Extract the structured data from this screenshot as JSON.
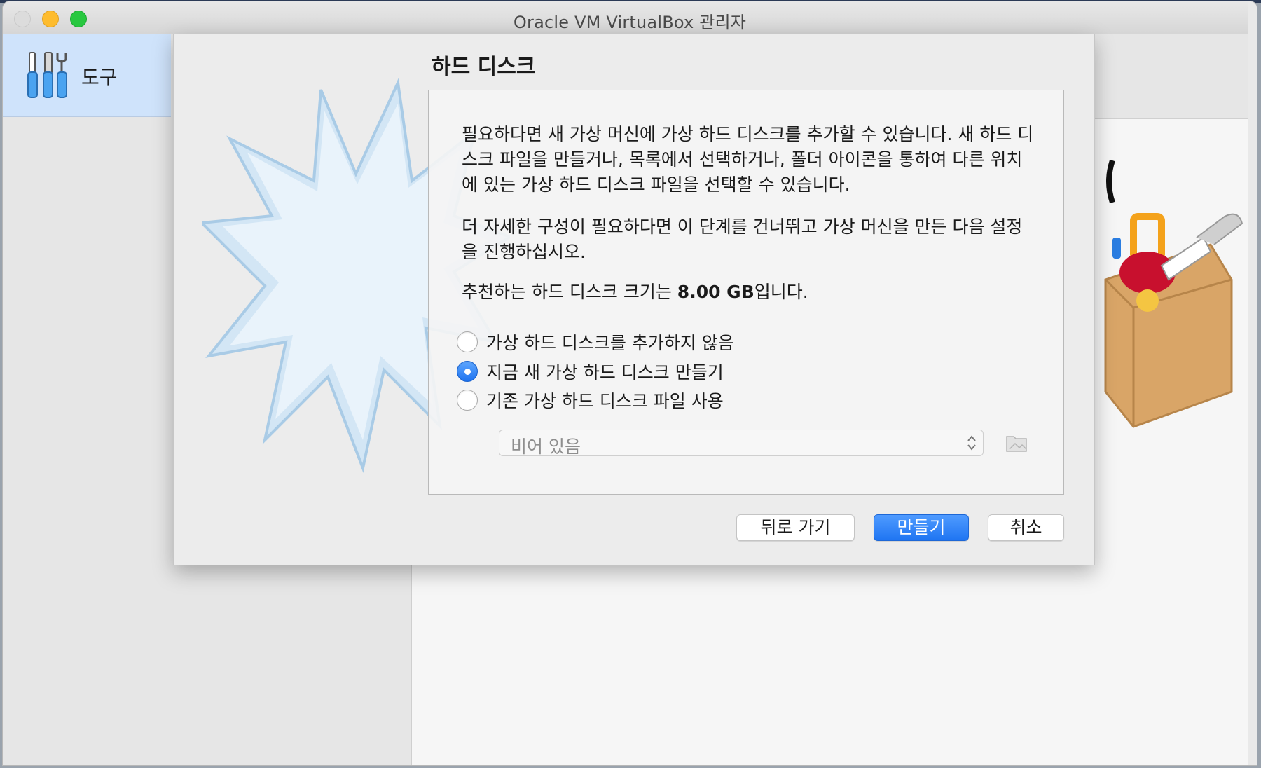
{
  "window": {
    "title": "Oracle VM VirtualBox 관리자"
  },
  "sidebar": {
    "tools_label": "도구"
  },
  "dialog": {
    "title": "하드 디스크",
    "paragraph1": "필요하다면 새 가상 머신에 가상 하드 디스크를 추가할 수 있습니다. 새 하드 디스크 파일을 만들거나, 목록에서 선택하거나, 폴더 아이콘을 통하여 다른 위치에 있는 가상 하드 디스크 파일을 선택할 수 있습니다.",
    "paragraph2": "더 자세한 구성이 필요하다면 이 단계를 건너뛰고 가상 머신을 만든 다음 설정을 진행하십시오.",
    "recommend_prefix": "추천하는 하드 디스크 크기는 ",
    "recommend_size": "8.00 GB",
    "recommend_suffix": "입니다.",
    "options": [
      {
        "label": "가상 하드 디스크를 추가하지 않음",
        "selected": false
      },
      {
        "label": "지금 새 가상 하드 디스크 만들기",
        "selected": true
      },
      {
        "label": "기존 가상 하드 디스크 파일 사용",
        "selected": false
      }
    ],
    "disk_select": {
      "value": "비어 있음"
    },
    "buttons": {
      "back": "뒤로 가기",
      "create": "만들기",
      "cancel": "취소"
    }
  },
  "colors": {
    "accent": "#1f75f2",
    "selection": "#cfe3fb"
  }
}
